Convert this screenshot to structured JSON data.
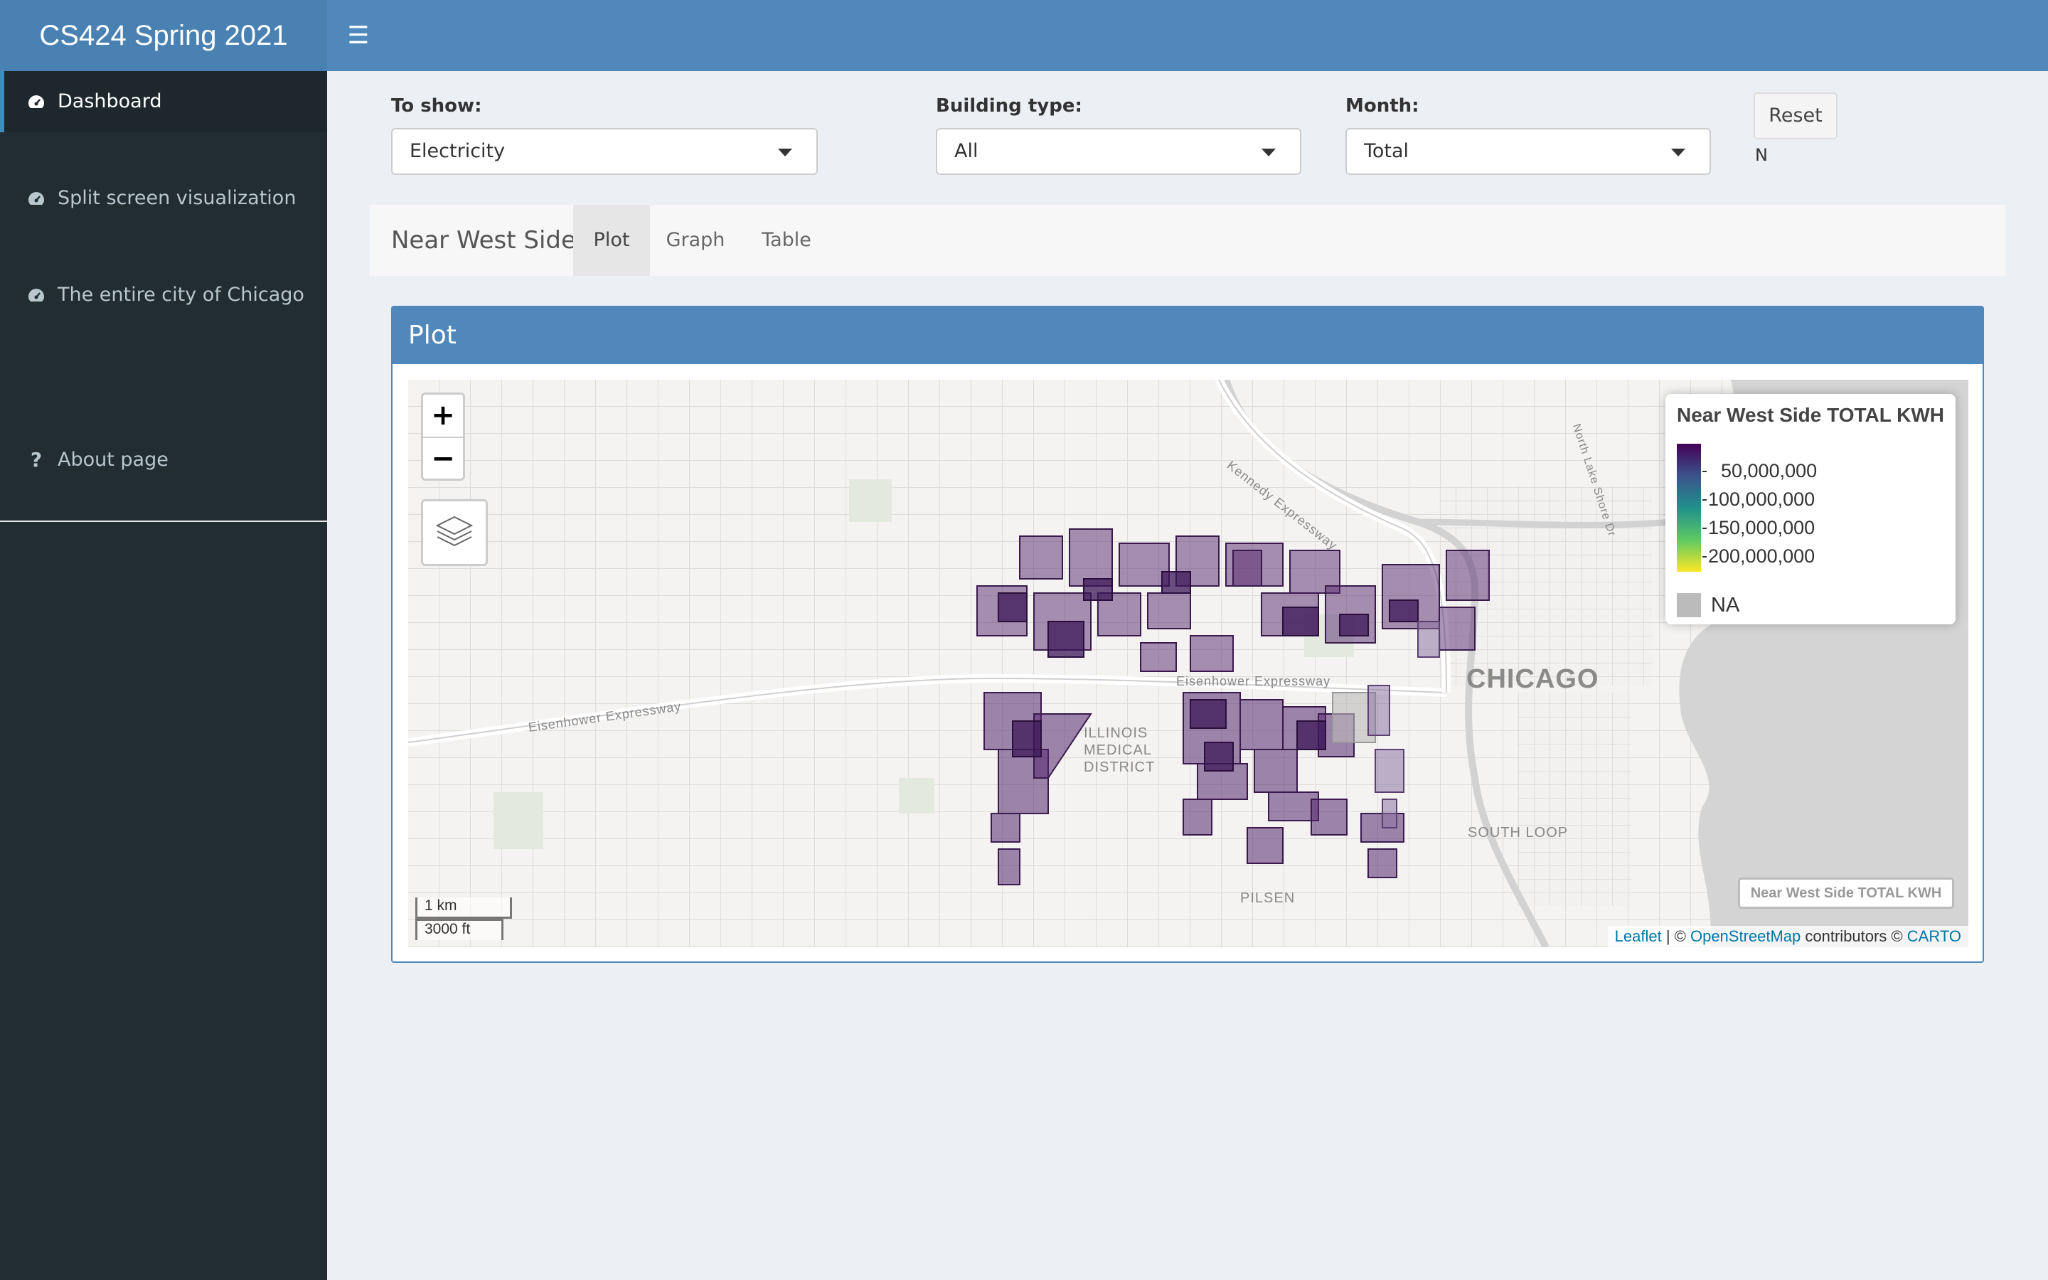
{
  "header": {
    "title": "CS424 Spring 2021",
    "toggle_icon": "hamburger-icon"
  },
  "sidebar": {
    "items": [
      {
        "label": "Dashboard",
        "icon": "dashboard-icon",
        "active": true
      },
      {
        "label": "Split screen visualization",
        "icon": "dashboard-icon"
      },
      {
        "label": "The entire city of Chicago",
        "icon": "dashboard-icon"
      },
      {
        "label": "About page",
        "icon": "question-icon"
      }
    ]
  },
  "controls": {
    "to_show": {
      "label": "To show:",
      "value": "Electricity"
    },
    "building_type": {
      "label": "Building type:",
      "value": "All"
    },
    "month": {
      "label": "Month:",
      "value": "Total"
    },
    "reset_label": "Reset",
    "n_text": "N"
  },
  "tabs": {
    "title": "Near West Side",
    "items": [
      {
        "label": "Plot",
        "active": true
      },
      {
        "label": "Graph"
      },
      {
        "label": "Table"
      }
    ]
  },
  "plot": {
    "title": "Plot",
    "zoom_in": "+",
    "zoom_out": "−",
    "legend": {
      "title": "Near West Side TOTAL KWH",
      "values": [
        "50,000,000",
        "100,000,000",
        "150,000,000",
        "200,000,000"
      ],
      "na_label": "NA",
      "colors": [
        "#440154",
        "#3b528b",
        "#21908c",
        "#5dc963",
        "#fde725"
      ]
    },
    "map_button": "Near West Side TOTAL KWH",
    "scale": {
      "km": "1 km",
      "ft": "3000 ft"
    },
    "attribution": {
      "leaflet": "Leaflet",
      "sep": " | © ",
      "osm": "OpenStreetMap",
      "contrib": " contributors © ",
      "carto": "CARTO"
    },
    "labels": {
      "chicago": "CHICAGO",
      "south_loop": "SOUTH LOOP",
      "pilsen": "PILSEN",
      "medical1": "ILLINOIS",
      "medical2": "MEDICAL",
      "medical3": "DISTRICT",
      "eisenhower": "Eisenhower Expressway",
      "kennedy": "Kennedy Expressway",
      "lakeshore": "North Lake Shore Dr"
    }
  }
}
